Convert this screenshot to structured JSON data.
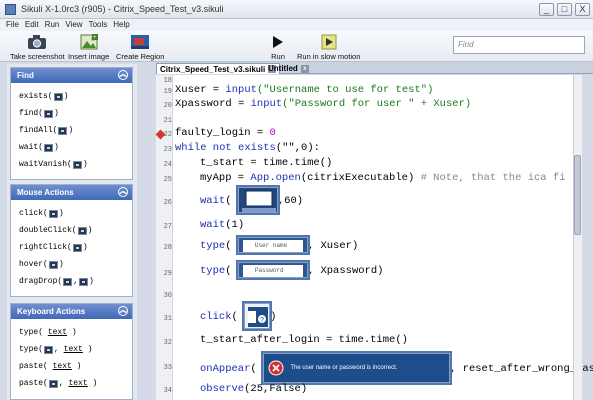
{
  "window": {
    "title": "Sikuli X-1.0rc3 (r905) - Citrix_Speed_Test_v3.sikuli",
    "buttons": [
      "_",
      "□",
      "X"
    ]
  },
  "menu": [
    "File",
    "Edit",
    "Run",
    "View",
    "Tools",
    "Help"
  ],
  "toolbar": {
    "take_screenshot": "Take screenshot",
    "insert_image": "Insert image",
    "create_region": "Create Region",
    "run": "Run",
    "run_slow": "Run in slow motion",
    "search_placeholder": "Find"
  },
  "palette": {
    "find": {
      "title": "Find",
      "items": [
        "exists(",
        "find(",
        "findAll(",
        "wait(",
        "waitVanish("
      ]
    },
    "mouse": {
      "title": "Mouse Actions",
      "items": [
        "click(",
        "doubleClick(",
        "rightClick(",
        "hover(",
        "dragDrop("
      ]
    },
    "keyboard": {
      "title": "Keyboard Actions",
      "items": [
        "type(",
        "type(",
        "paste(",
        "paste("
      ]
    },
    "close_paren": ")",
    "text_word": "text",
    "comma": ","
  },
  "tabs": [
    "Citrix_Speed_Test_v3.sikuli",
    "Untitled"
  ],
  "code": {
    "line_numbers": [
      "18",
      "19",
      "20",
      "21",
      "22",
      "23",
      "24",
      "25",
      "26",
      "27",
      "28",
      "29",
      "30",
      "31",
      "32",
      "33",
      "34"
    ],
    "l19_a": "Xuser = ",
    "l19_fn": "input",
    "l19_str": "(\"Username to use for test\")",
    "l20_a": "Xpassword = ",
    "l20_fn": "input",
    "l20_str": "(\"Password for user \" + Xuser)",
    "l22_a": "faulty_login = ",
    "l22_num": "0",
    "l23_kw1": "while not ",
    "l23_fn": "exists",
    "l23_b": "(\"\",0):",
    "l24": "t_start = time.time()",
    "l25_a": "myApp = ",
    "l25_fn": "App.open",
    "l25_b": "(citrixExecutable) ",
    "l25_cm": "# Note, that the ica fi",
    "l26_fn": "wait",
    "l26_b": ",60)",
    "l27_fn": "wait",
    "l27_b": "(1)",
    "l28_fn": "type",
    "l28_b": ", Xuser)",
    "l28_img": "User name",
    "l29_fn": "type",
    "l29_b": ", Xpassword)",
    "l29_img": "Password",
    "l31_fn": "click",
    "l32": "t_start_after_login = time.time()",
    "l33_fn": "onAppear",
    "l33_b": ", reset_after_wrong_pass",
    "l33_img": "The user name or password is incorrect.",
    "l34_fn": "observe",
    "l34_b": "(25,False)",
    "paren_open": "(",
    "paren_close": ")"
  }
}
